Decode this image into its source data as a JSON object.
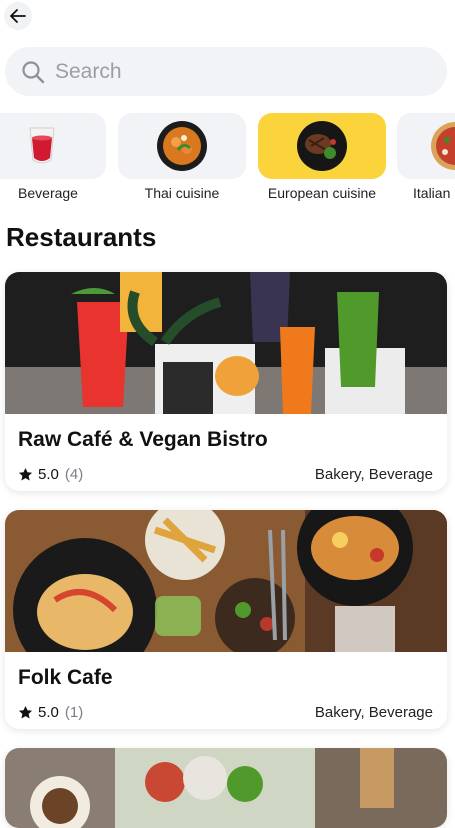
{
  "search": {
    "placeholder": "Search"
  },
  "categories": [
    {
      "label": "Beverage",
      "icon": "red-drink-icon"
    },
    {
      "label": "Thai cuisine",
      "icon": "thai-dish-icon"
    },
    {
      "label": "European cuisine",
      "icon": "steak-dish-icon",
      "selected": true
    },
    {
      "label": "Italian",
      "icon": "pizza-icon"
    }
  ],
  "section_title": "Restaurants",
  "restaurants": [
    {
      "name": "Raw Café & Vegan Bistro",
      "rating": "5.0",
      "count": "(4)",
      "tags": "Bakery, Beverage"
    },
    {
      "name": "Folk Cafe",
      "rating": "5.0",
      "count": "(1)",
      "tags": "Bakery, Beverage"
    }
  ],
  "colors": {
    "accent": "#fbd43c",
    "tile_bg": "#f2f3f6",
    "placeholder": "#9a9ea6"
  }
}
